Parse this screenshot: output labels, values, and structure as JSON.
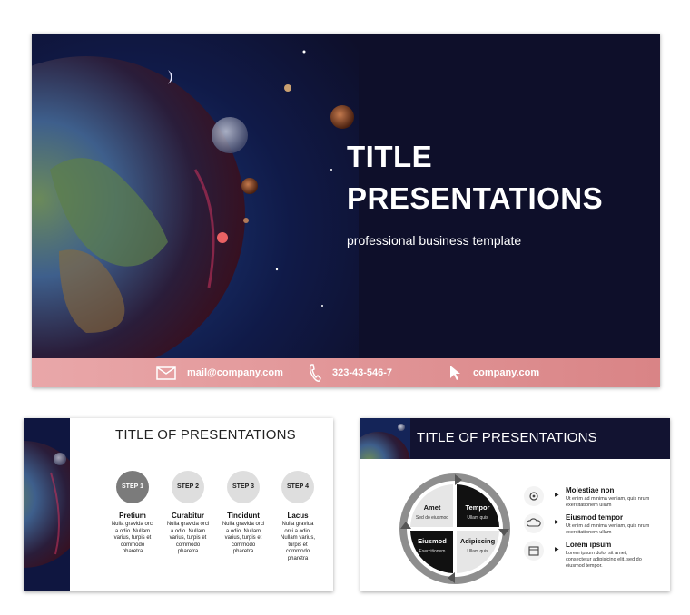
{
  "main_slide": {
    "title_line1": "TITLE",
    "title_line2": "PRESENTATIONS",
    "subtitle": "professional business template",
    "contact_email": "mail@company.com",
    "contact_phone": "323-43-546-7",
    "contact_web": "company.com",
    "colors": {
      "background": "#0e0f2a",
      "contact_bar": "#de8e90"
    }
  },
  "slide2": {
    "title": "TITLE OF PRESENTATIONS",
    "steps": [
      {
        "label": "STEP 1",
        "heading": "Pretium",
        "lines": [
          "Nulla gravida orci",
          "a odio. Nullam",
          "varius, turpis et",
          "commodo",
          "pharetra"
        ]
      },
      {
        "label": "STEP 2",
        "heading": "Curabitur",
        "lines": [
          "Nulla gravida orci",
          "a odio. Nullam",
          "varius, turpis et",
          "commodo",
          "pharetra"
        ]
      },
      {
        "label": "STEP 3",
        "heading": "Tincidunt",
        "lines": [
          "Nulla gravida orci",
          "a odio. Nullam",
          "varius, turpis et",
          "commodo",
          "pharetra"
        ]
      },
      {
        "label": "STEP 4",
        "heading": "Lacus",
        "lines": [
          "Nulla gravida",
          "orci a odio.",
          "Nullam varius,",
          "turpis et",
          "commodo",
          "pharetra"
        ]
      }
    ]
  },
  "slide3": {
    "title": "TITLE OF PRESENTATIONS",
    "quadrants": [
      {
        "title": "Amet",
        "sub": "Sed do eiusmod"
      },
      {
        "title": "Tempor",
        "sub": "Ullam quis"
      },
      {
        "title": "Eiusmod",
        "sub": "Exercitionem"
      },
      {
        "title": "Adipiscing",
        "sub": "Ullam quis"
      }
    ],
    "features": [
      {
        "icon": "gear-icon",
        "heading": "Molestiae non",
        "lines": [
          "Ut enim ad minima veniam, quis nrum",
          "exercitationem ullam"
        ]
      },
      {
        "icon": "cloud-icon",
        "heading": "Eiusmod tempor",
        "lines": [
          "Ut enim ad minima veniam, quis nrum",
          "exercitationem ullam"
        ]
      },
      {
        "icon": "calendar-icon",
        "heading": "Lorem ipsum",
        "lines": [
          "Lorem ipsum dolor sit amet,",
          "consectetur adipisicing elit, sed do",
          "eiusmod tempor."
        ]
      }
    ]
  }
}
